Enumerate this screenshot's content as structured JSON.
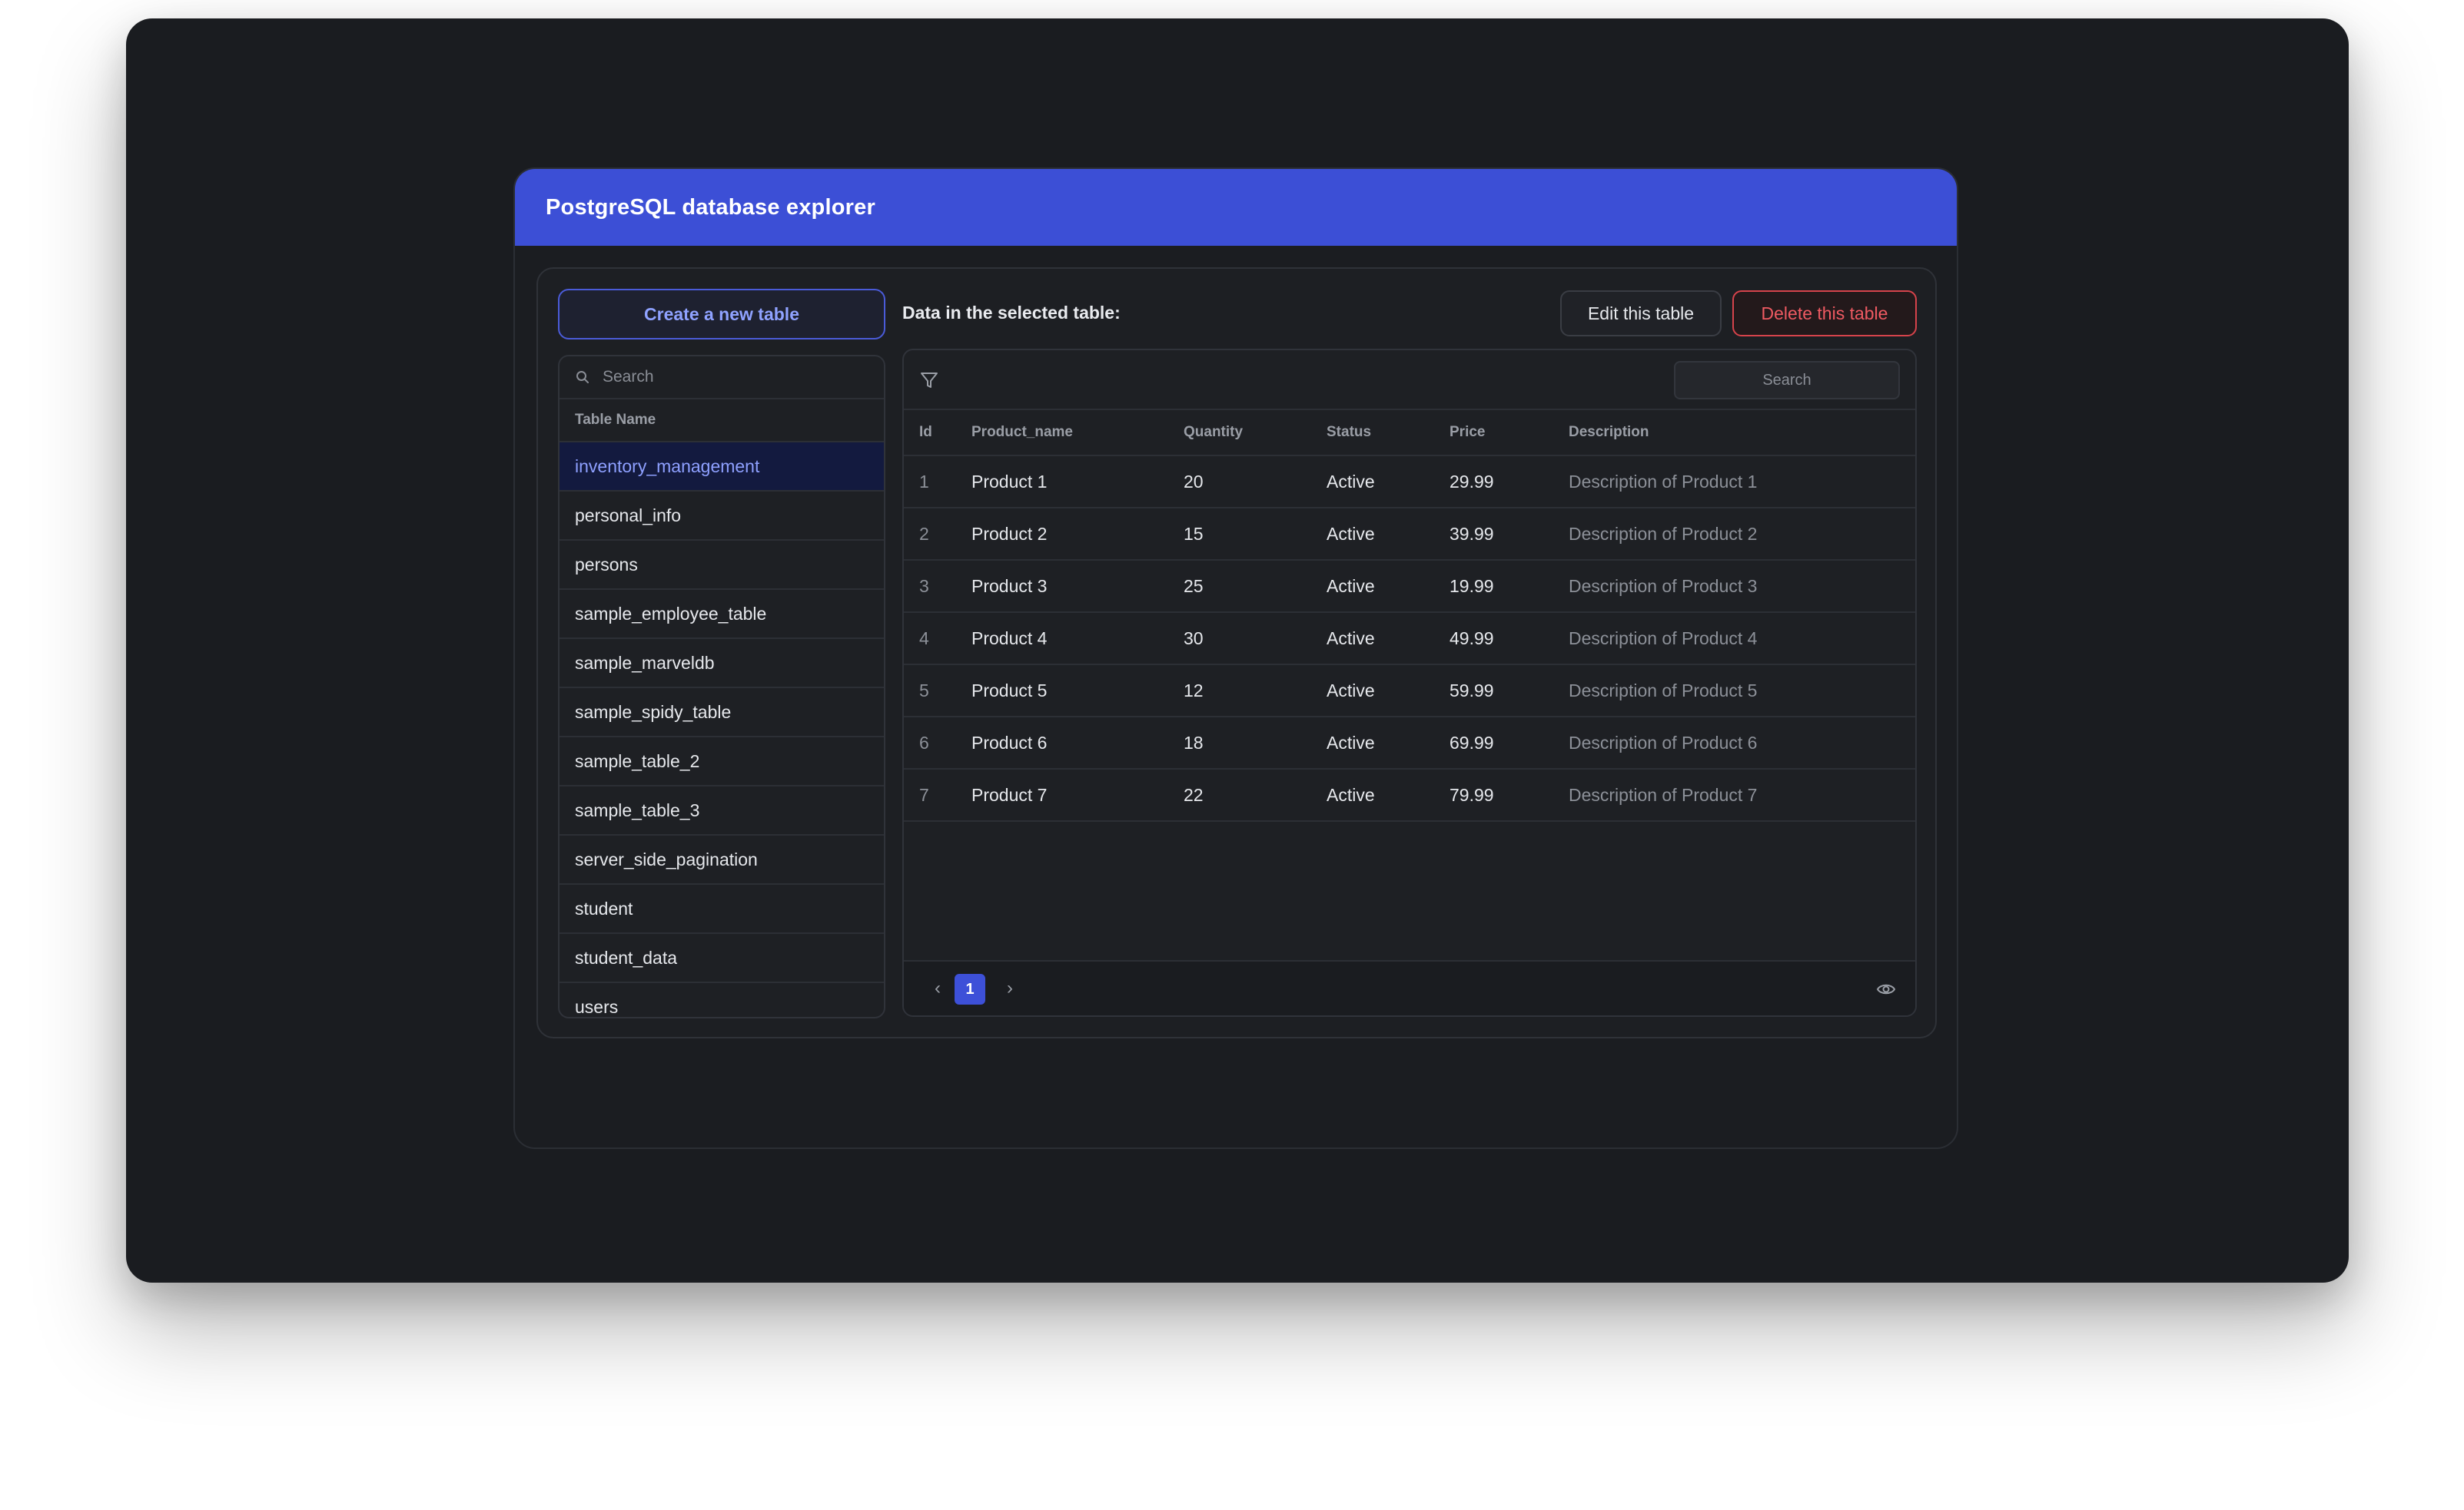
{
  "app": {
    "title": "PostgreSQL database explorer"
  },
  "left": {
    "create_label": "Create a new table",
    "search_placeholder": "Search",
    "column_header": "Table Name",
    "tables": [
      "inventory_management",
      "personal_info",
      "persons",
      "sample_employee_table",
      "sample_marveldb",
      "sample_spidy_table",
      "sample_table_2",
      "sample_table_3",
      "server_side_pagination",
      "student",
      "student_data",
      "users"
    ],
    "selected_index": 0
  },
  "right": {
    "label": "Data in the selected table:",
    "edit_label": "Edit this table",
    "delete_label": "Delete this table",
    "search_placeholder": "Search",
    "columns": [
      "Id",
      "Product_name",
      "Quantity",
      "Status",
      "Price",
      "Description"
    ],
    "rows": [
      [
        "1",
        "Product 1",
        "20",
        "Active",
        "29.99",
        "Description of Product 1"
      ],
      [
        "2",
        "Product 2",
        "15",
        "Active",
        "39.99",
        "Description of Product 2"
      ],
      [
        "3",
        "Product 3",
        "25",
        "Active",
        "19.99",
        "Description of Product 3"
      ],
      [
        "4",
        "Product 4",
        "30",
        "Active",
        "49.99",
        "Description of Product 4"
      ],
      [
        "5",
        "Product 5",
        "12",
        "Active",
        "59.99",
        "Description of Product 5"
      ],
      [
        "6",
        "Product 6",
        "18",
        "Active",
        "69.99",
        "Description of Product 6"
      ],
      [
        "7",
        "Product 7",
        "22",
        "Active",
        "79.99",
        "Description of Product 7"
      ]
    ],
    "pagination": {
      "prev": "‹",
      "current_page": "1",
      "next": "›"
    }
  },
  "icons": {
    "search": "search-icon",
    "filter": "filter-icon",
    "visibility": "eye-icon"
  },
  "colors": {
    "accent": "#3c4fd6",
    "danger": "#ef5a62",
    "background": "#1a1c20"
  }
}
